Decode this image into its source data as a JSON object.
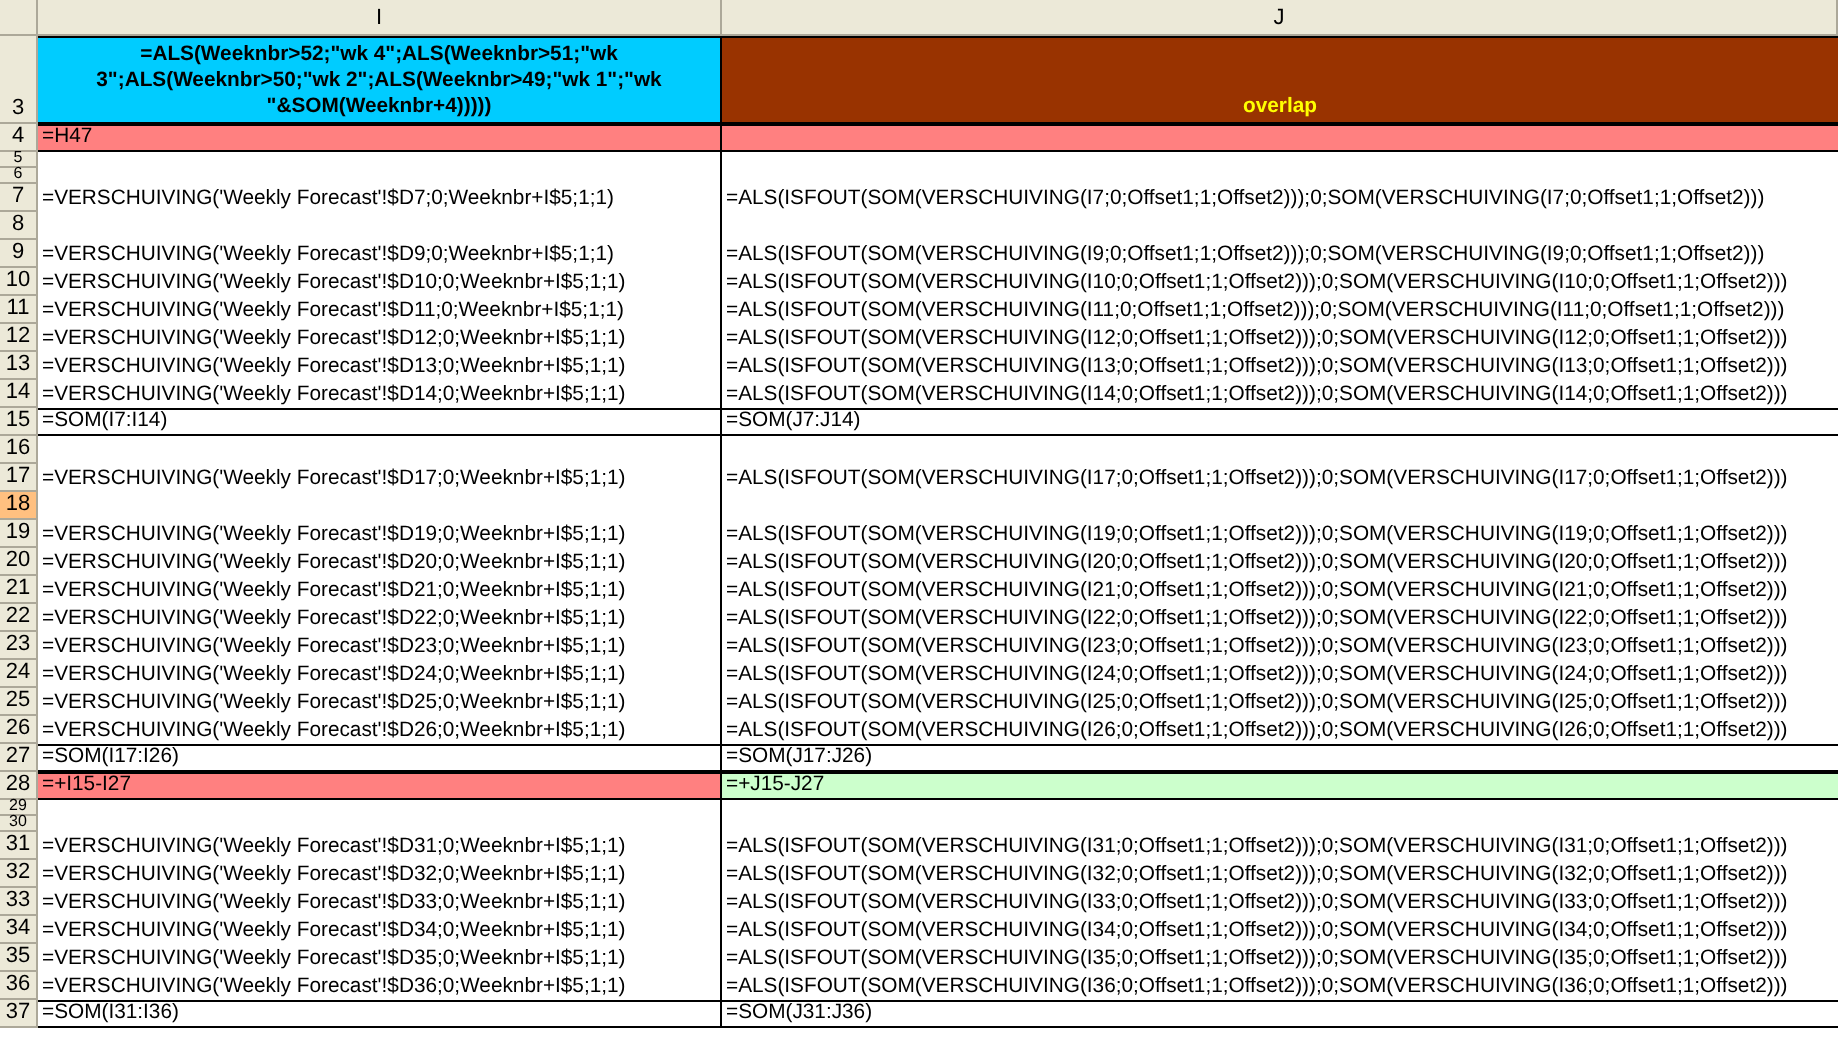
{
  "columns": [
    {
      "label": "I"
    },
    {
      "label": "J"
    }
  ],
  "rows": [
    {
      "number": "3",
      "kind": "tall",
      "selected": false,
      "boxed": true,
      "cells": [
        {
          "text": "=ALS(Weeknbr>52;\"wk 4\";ALS(Weeknbr>51;\"wk 3\";ALS(Weeknbr>50;\"wk 2\";ALS(Weeknbr>49;\"wk 1\";\"wk \"&SOM(Weeknbr+4)))))",
          "color": "#00ccff",
          "bold": true
        },
        {
          "text": "overlap",
          "color": "#993300",
          "bold": true
        }
      ]
    },
    {
      "number": "4",
      "kind": "normal",
      "selected": false,
      "boxed": true,
      "cells": [
        {
          "text": "=H47",
          "color": "#ff8080"
        },
        {
          "text": "",
          "color": "#ff8080"
        }
      ]
    },
    {
      "number": "5",
      "kind": "short",
      "selected": false,
      "boxed": false,
      "cells": [
        {
          "text": ""
        },
        {
          "text": ""
        }
      ]
    },
    {
      "number": "6",
      "kind": "short",
      "selected": false,
      "boxed": false,
      "cells": [
        {
          "text": ""
        },
        {
          "text": ""
        }
      ]
    },
    {
      "number": "7",
      "kind": "normal",
      "selected": false,
      "boxed": false,
      "cells": [
        {
          "text": "=VERSCHUIVING('Weekly Forecast'!$D7;0;Weeknbr+I$5;1;1)"
        },
        {
          "text": "=ALS(ISFOUT(SOM(VERSCHUIVING(I7;0;Offset1;1;Offset2)));0;SOM(VERSCHUIVING(I7;0;Offset1;1;Offset2)))"
        }
      ]
    },
    {
      "number": "8",
      "kind": "normal",
      "selected": false,
      "boxed": false,
      "cells": [
        {
          "text": ""
        },
        {
          "text": ""
        }
      ]
    },
    {
      "number": "9",
      "kind": "normal",
      "selected": false,
      "boxed": false,
      "cells": [
        {
          "text": "=VERSCHUIVING('Weekly Forecast'!$D9;0;Weeknbr+I$5;1;1)"
        },
        {
          "text": "=ALS(ISFOUT(SOM(VERSCHUIVING(I9;0;Offset1;1;Offset2)));0;SOM(VERSCHUIVING(I9;0;Offset1;1;Offset2)))"
        }
      ]
    },
    {
      "number": "10",
      "kind": "normal",
      "selected": false,
      "boxed": false,
      "cells": [
        {
          "text": "=VERSCHUIVING('Weekly Forecast'!$D10;0;Weeknbr+I$5;1;1)"
        },
        {
          "text": "=ALS(ISFOUT(SOM(VERSCHUIVING(I10;0;Offset1;1;Offset2)));0;SOM(VERSCHUIVING(I10;0;Offset1;1;Offset2)))"
        }
      ]
    },
    {
      "number": "11",
      "kind": "normal",
      "selected": false,
      "boxed": false,
      "cells": [
        {
          "text": "=VERSCHUIVING('Weekly Forecast'!$D11;0;Weeknbr+I$5;1;1)"
        },
        {
          "text": "=ALS(ISFOUT(SOM(VERSCHUIVING(I11;0;Offset1;1;Offset2)));0;SOM(VERSCHUIVING(I11;0;Offset1;1;Offset2)))"
        }
      ]
    },
    {
      "number": "12",
      "kind": "normal",
      "selected": false,
      "boxed": false,
      "cells": [
        {
          "text": "=VERSCHUIVING('Weekly Forecast'!$D12;0;Weeknbr+I$5;1;1)"
        },
        {
          "text": "=ALS(ISFOUT(SOM(VERSCHUIVING(I12;0;Offset1;1;Offset2)));0;SOM(VERSCHUIVING(I12;0;Offset1;1;Offset2)))"
        }
      ]
    },
    {
      "number": "13",
      "kind": "normal",
      "selected": false,
      "boxed": false,
      "cells": [
        {
          "text": "=VERSCHUIVING('Weekly Forecast'!$D13;0;Weeknbr+I$5;1;1)"
        },
        {
          "text": "=ALS(ISFOUT(SOM(VERSCHUIVING(I13;0;Offset1;1;Offset2)));0;SOM(VERSCHUIVING(I13;0;Offset1;1;Offset2)))"
        }
      ]
    },
    {
      "number": "14",
      "kind": "normal",
      "selected": false,
      "boxed": false,
      "cells": [
        {
          "text": "=VERSCHUIVING('Weekly Forecast'!$D14;0;Weeknbr+I$5;1;1)"
        },
        {
          "text": "=ALS(ISFOUT(SOM(VERSCHUIVING(I14;0;Offset1;1;Offset2)));0;SOM(VERSCHUIVING(I14;0;Offset1;1;Offset2)))"
        }
      ]
    },
    {
      "number": "15",
      "kind": "normal",
      "selected": false,
      "boxed": true,
      "cells": [
        {
          "text": "=SOM(I7:I14)"
        },
        {
          "text": "=SOM(J7:J14)"
        }
      ]
    },
    {
      "number": "16",
      "kind": "normal",
      "selected": false,
      "boxed": false,
      "cells": [
        {
          "text": ""
        },
        {
          "text": ""
        }
      ]
    },
    {
      "number": "17",
      "kind": "normal",
      "selected": false,
      "boxed": false,
      "cells": [
        {
          "text": "=VERSCHUIVING('Weekly Forecast'!$D17;0;Weeknbr+I$5;1;1)"
        },
        {
          "text": "=ALS(ISFOUT(SOM(VERSCHUIVING(I17;0;Offset1;1;Offset2)));0;SOM(VERSCHUIVING(I17;0;Offset1;1;Offset2)))"
        }
      ]
    },
    {
      "number": "18",
      "kind": "normal",
      "selected": true,
      "boxed": false,
      "cells": [
        {
          "text": ""
        },
        {
          "text": ""
        }
      ]
    },
    {
      "number": "19",
      "kind": "normal",
      "selected": false,
      "boxed": false,
      "cells": [
        {
          "text": "=VERSCHUIVING('Weekly Forecast'!$D19;0;Weeknbr+I$5;1;1)"
        },
        {
          "text": "=ALS(ISFOUT(SOM(VERSCHUIVING(I19;0;Offset1;1;Offset2)));0;SOM(VERSCHUIVING(I19;0;Offset1;1;Offset2)))"
        }
      ]
    },
    {
      "number": "20",
      "kind": "normal",
      "selected": false,
      "boxed": false,
      "cells": [
        {
          "text": "=VERSCHUIVING('Weekly Forecast'!$D20;0;Weeknbr+I$5;1;1)"
        },
        {
          "text": "=ALS(ISFOUT(SOM(VERSCHUIVING(I20;0;Offset1;1;Offset2)));0;SOM(VERSCHUIVING(I20;0;Offset1;1;Offset2)))"
        }
      ]
    },
    {
      "number": "21",
      "kind": "normal",
      "selected": false,
      "boxed": false,
      "cells": [
        {
          "text": "=VERSCHUIVING('Weekly Forecast'!$D21;0;Weeknbr+I$5;1;1)"
        },
        {
          "text": "=ALS(ISFOUT(SOM(VERSCHUIVING(I21;0;Offset1;1;Offset2)));0;SOM(VERSCHUIVING(I21;0;Offset1;1;Offset2)))"
        }
      ]
    },
    {
      "number": "22",
      "kind": "normal",
      "selected": false,
      "boxed": false,
      "cells": [
        {
          "text": "=VERSCHUIVING('Weekly Forecast'!$D22;0;Weeknbr+I$5;1;1)"
        },
        {
          "text": "=ALS(ISFOUT(SOM(VERSCHUIVING(I22;0;Offset1;1;Offset2)));0;SOM(VERSCHUIVING(I22;0;Offset1;1;Offset2)))"
        }
      ]
    },
    {
      "number": "23",
      "kind": "normal",
      "selected": false,
      "boxed": false,
      "cells": [
        {
          "text": "=VERSCHUIVING('Weekly Forecast'!$D23;0;Weeknbr+I$5;1;1)"
        },
        {
          "text": "=ALS(ISFOUT(SOM(VERSCHUIVING(I23;0;Offset1;1;Offset2)));0;SOM(VERSCHUIVING(I23;0;Offset1;1;Offset2)))"
        }
      ]
    },
    {
      "number": "24",
      "kind": "normal",
      "selected": false,
      "boxed": false,
      "cells": [
        {
          "text": "=VERSCHUIVING('Weekly Forecast'!$D24;0;Weeknbr+I$5;1;1)"
        },
        {
          "text": "=ALS(ISFOUT(SOM(VERSCHUIVING(I24;0;Offset1;1;Offset2)));0;SOM(VERSCHUIVING(I24;0;Offset1;1;Offset2)))"
        }
      ]
    },
    {
      "number": "25",
      "kind": "normal",
      "selected": false,
      "boxed": false,
      "cells": [
        {
          "text": "=VERSCHUIVING('Weekly Forecast'!$D25;0;Weeknbr+I$5;1;1)"
        },
        {
          "text": "=ALS(ISFOUT(SOM(VERSCHUIVING(I25;0;Offset1;1;Offset2)));0;SOM(VERSCHUIVING(I25;0;Offset1;1;Offset2)))"
        }
      ]
    },
    {
      "number": "26",
      "kind": "normal",
      "selected": false,
      "boxed": false,
      "cells": [
        {
          "text": "=VERSCHUIVING('Weekly Forecast'!$D26;0;Weeknbr+I$5;1;1)"
        },
        {
          "text": "=ALS(ISFOUT(SOM(VERSCHUIVING(I26;0;Offset1;1;Offset2)));0;SOM(VERSCHUIVING(I26;0;Offset1;1;Offset2)))"
        }
      ]
    },
    {
      "number": "27",
      "kind": "normal",
      "selected": false,
      "boxed": true,
      "cells": [
        {
          "text": "=SOM(I17:I26)"
        },
        {
          "text": "=SOM(J17:J26)"
        }
      ]
    },
    {
      "number": "28",
      "kind": "normal",
      "selected": false,
      "boxed": true,
      "cells": [
        {
          "text": "=+I15-I27",
          "color": "#ff8080"
        },
        {
          "text": "=+J15-J27",
          "color": "#ccffcc"
        }
      ]
    },
    {
      "number": "29",
      "kind": "short",
      "selected": false,
      "boxed": false,
      "cells": [
        {
          "text": ""
        },
        {
          "text": ""
        }
      ]
    },
    {
      "number": "30",
      "kind": "short",
      "selected": false,
      "boxed": false,
      "cells": [
        {
          "text": ""
        },
        {
          "text": ""
        }
      ]
    },
    {
      "number": "31",
      "kind": "normal",
      "selected": false,
      "boxed": false,
      "cells": [
        {
          "text": "=VERSCHUIVING('Weekly Forecast'!$D31;0;Weeknbr+I$5;1;1)"
        },
        {
          "text": "=ALS(ISFOUT(SOM(VERSCHUIVING(I31;0;Offset1;1;Offset2)));0;SOM(VERSCHUIVING(I31;0;Offset1;1;Offset2)))"
        }
      ]
    },
    {
      "number": "32",
      "kind": "normal",
      "selected": false,
      "boxed": false,
      "cells": [
        {
          "text": "=VERSCHUIVING('Weekly Forecast'!$D32;0;Weeknbr+I$5;1;1)"
        },
        {
          "text": "=ALS(ISFOUT(SOM(VERSCHUIVING(I32;0;Offset1;1;Offset2)));0;SOM(VERSCHUIVING(I32;0;Offset1;1;Offset2)))"
        }
      ]
    },
    {
      "number": "33",
      "kind": "normal",
      "selected": false,
      "boxed": false,
      "cells": [
        {
          "text": "=VERSCHUIVING('Weekly Forecast'!$D33;0;Weeknbr+I$5;1;1)"
        },
        {
          "text": "=ALS(ISFOUT(SOM(VERSCHUIVING(I33;0;Offset1;1;Offset2)));0;SOM(VERSCHUIVING(I33;0;Offset1;1;Offset2)))"
        }
      ]
    },
    {
      "number": "34",
      "kind": "normal",
      "selected": false,
      "boxed": false,
      "cells": [
        {
          "text": "=VERSCHUIVING('Weekly Forecast'!$D34;0;Weeknbr+I$5;1;1)"
        },
        {
          "text": "=ALS(ISFOUT(SOM(VERSCHUIVING(I34;0;Offset1;1;Offset2)));0;SOM(VERSCHUIVING(I34;0;Offset1;1;Offset2)))"
        }
      ]
    },
    {
      "number": "35",
      "kind": "normal",
      "selected": false,
      "boxed": false,
      "cells": [
        {
          "text": "=VERSCHUIVING('Weekly Forecast'!$D35;0;Weeknbr+I$5;1;1)"
        },
        {
          "text": "=ALS(ISFOUT(SOM(VERSCHUIVING(I35;0;Offset1;1;Offset2)));0;SOM(VERSCHUIVING(I35;0;Offset1;1;Offset2)))"
        }
      ]
    },
    {
      "number": "36",
      "kind": "normal",
      "selected": false,
      "boxed": false,
      "cells": [
        {
          "text": "=VERSCHUIVING('Weekly Forecast'!$D36;0;Weeknbr+I$5;1;1)"
        },
        {
          "text": "=ALS(ISFOUT(SOM(VERSCHUIVING(I36;0;Offset1;1;Offset2)));0;SOM(VERSCHUIVING(I36;0;Offset1;1;Offset2)))"
        }
      ]
    },
    {
      "number": "37",
      "kind": "normal",
      "selected": false,
      "boxed": true,
      "cells": [
        {
          "text": "=SOM(I31:I36)"
        },
        {
          "text": "=SOM(J31:J36)"
        }
      ]
    }
  ]
}
